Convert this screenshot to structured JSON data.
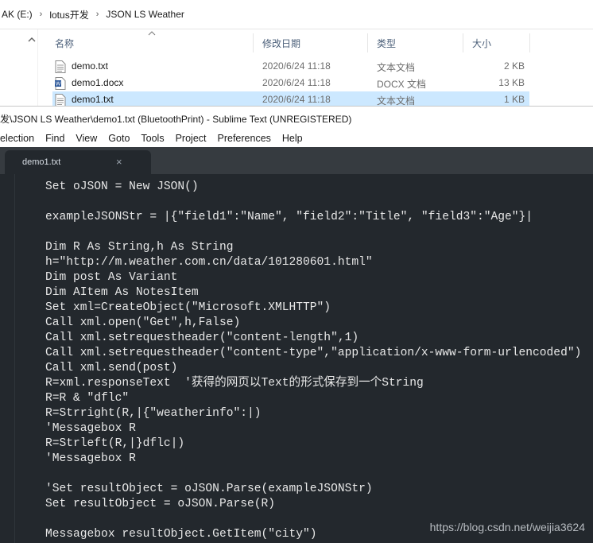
{
  "explorer": {
    "breadcrumb": [
      "AK (E:)",
      "lotus开发",
      "JSON LS Weather"
    ],
    "columns": {
      "name": "名称",
      "date": "修改日期",
      "type": "类型",
      "size": "大小"
    },
    "files": [
      {
        "name": "demo.txt",
        "date": "2020/6/24 11:18",
        "type": "文本文档",
        "size": "2 KB",
        "icon": "text-file-icon"
      },
      {
        "name": "demo1.docx",
        "date": "2020/6/24 11:18",
        "type": "DOCX 文档",
        "size": "13 KB",
        "icon": "word-file-icon"
      },
      {
        "name": "demo1.txt",
        "date": "2020/6/24 11:18",
        "type": "文本文档",
        "size": "1 KB",
        "icon": "text-file-icon",
        "selected": true
      }
    ]
  },
  "sublime": {
    "title": "发\\JSON LS Weather\\demo1.txt (BluetoothPrint) - Sublime Text (UNREGISTERED)",
    "menu": [
      "election",
      "Find",
      "View",
      "Goto",
      "Tools",
      "Project",
      "Preferences",
      "Help"
    ],
    "tab": {
      "label": "demo1.txt",
      "close": "×"
    },
    "code_lines": [
      "Set oJSON = New JSON()",
      "",
      "exampleJSONStr = |{\"field1\":\"Name\", \"field2\":\"Title\", \"field3\":\"Age\"}|",
      "",
      "Dim R As String,h As String",
      "h=\"http://m.weather.com.cn/data/101280601.html\"",
      "Dim post As Variant",
      "Dim AItem As NotesItem",
      "Set xml=CreateObject(\"Microsoft.XMLHTTP\")",
      "Call xml.open(\"Get\",h,False)",
      "Call xml.setrequestheader(\"content-length\",1)",
      "Call xml.setrequestheader(\"content-type\",\"application/x-www-form-urlencoded\")",
      "Call xml.send(post)",
      "R=xml.responseText  '获得的网页以Text的形式保存到一个String",
      "R=R & \"dflc\"",
      "R=Strright(R,|{\"weatherinfo\":|)",
      "'Messagebox R",
      "R=Strleft(R,|}dflc|)",
      "'Messagebox R",
      "",
      "'Set resultObject = oJSON.Parse(exampleJSONStr)",
      "Set resultObject = oJSON.Parse(R)",
      "",
      "Messagebox resultObject.GetItem(\"city\")"
    ],
    "watermark": "https://blog.csdn.net/weijia3624"
  },
  "colors": {
    "editor_bg": "#23282d",
    "tabbar_bg": "#363b40",
    "selected_row": "#cce8ff",
    "header_text": "#4c607a"
  }
}
